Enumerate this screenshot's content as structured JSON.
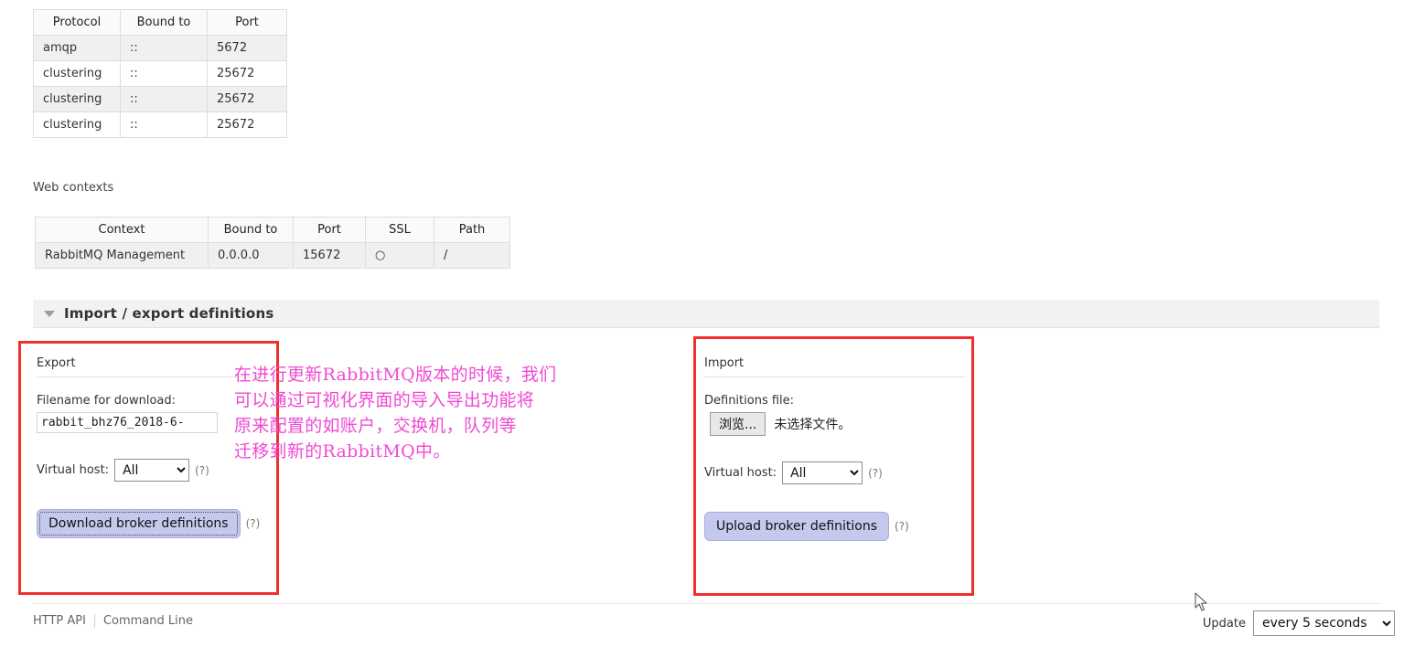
{
  "listeners_table": {
    "columns": [
      "Protocol",
      "Bound to",
      "Port"
    ],
    "rows": [
      [
        "amqp",
        "::",
        "5672"
      ],
      [
        "clustering",
        "::",
        "25672"
      ],
      [
        "clustering",
        "::",
        "25672"
      ],
      [
        "clustering",
        "::",
        "25672"
      ]
    ]
  },
  "web_contexts": {
    "label": "Web contexts",
    "columns": [
      "Context",
      "Bound to",
      "Port",
      "SSL",
      "Path"
    ],
    "rows": [
      [
        "RabbitMQ Management",
        "0.0.0.0",
        "15672",
        "○",
        "/"
      ]
    ]
  },
  "section": {
    "title": "Import / export definitions",
    "collapse_icon": "triangle-down-icon"
  },
  "export_panel": {
    "heading": "Export",
    "filename_label": "Filename for download:",
    "filename_value": "rabbit_bhz76_2018-6-",
    "vhost_label": "Virtual host:",
    "vhost_value": "All",
    "vhost_options": [
      "All"
    ],
    "vhost_hint": "(?)",
    "download_button": "Download broker definitions",
    "download_hint": "(?)"
  },
  "import_panel": {
    "heading": "Import",
    "definitions_label": "Definitions file:",
    "browse_button": "浏览...",
    "file_status": "未选择文件。",
    "vhost_label": "Virtual host:",
    "vhost_value": "All",
    "vhost_options": [
      "All"
    ],
    "vhost_hint": "(?)",
    "upload_button": "Upload broker definitions",
    "upload_hint": "(?)"
  },
  "annotation": {
    "note_text": "在进行更新RabbitMQ版本的时候，我们\n可以通过可视化界面的导入导出功能将\n原来配置的如账户，交换机，队列等\n迁移到新的RabbitMQ中。",
    "box_color": "#f02f2f",
    "text_color": "#ef4ad2"
  },
  "footer": {
    "http_api": "HTTP API",
    "command_line": "Command Line",
    "update_label": "Update",
    "update_value": "every 5 seconds",
    "update_options": [
      "every 5 seconds"
    ]
  }
}
